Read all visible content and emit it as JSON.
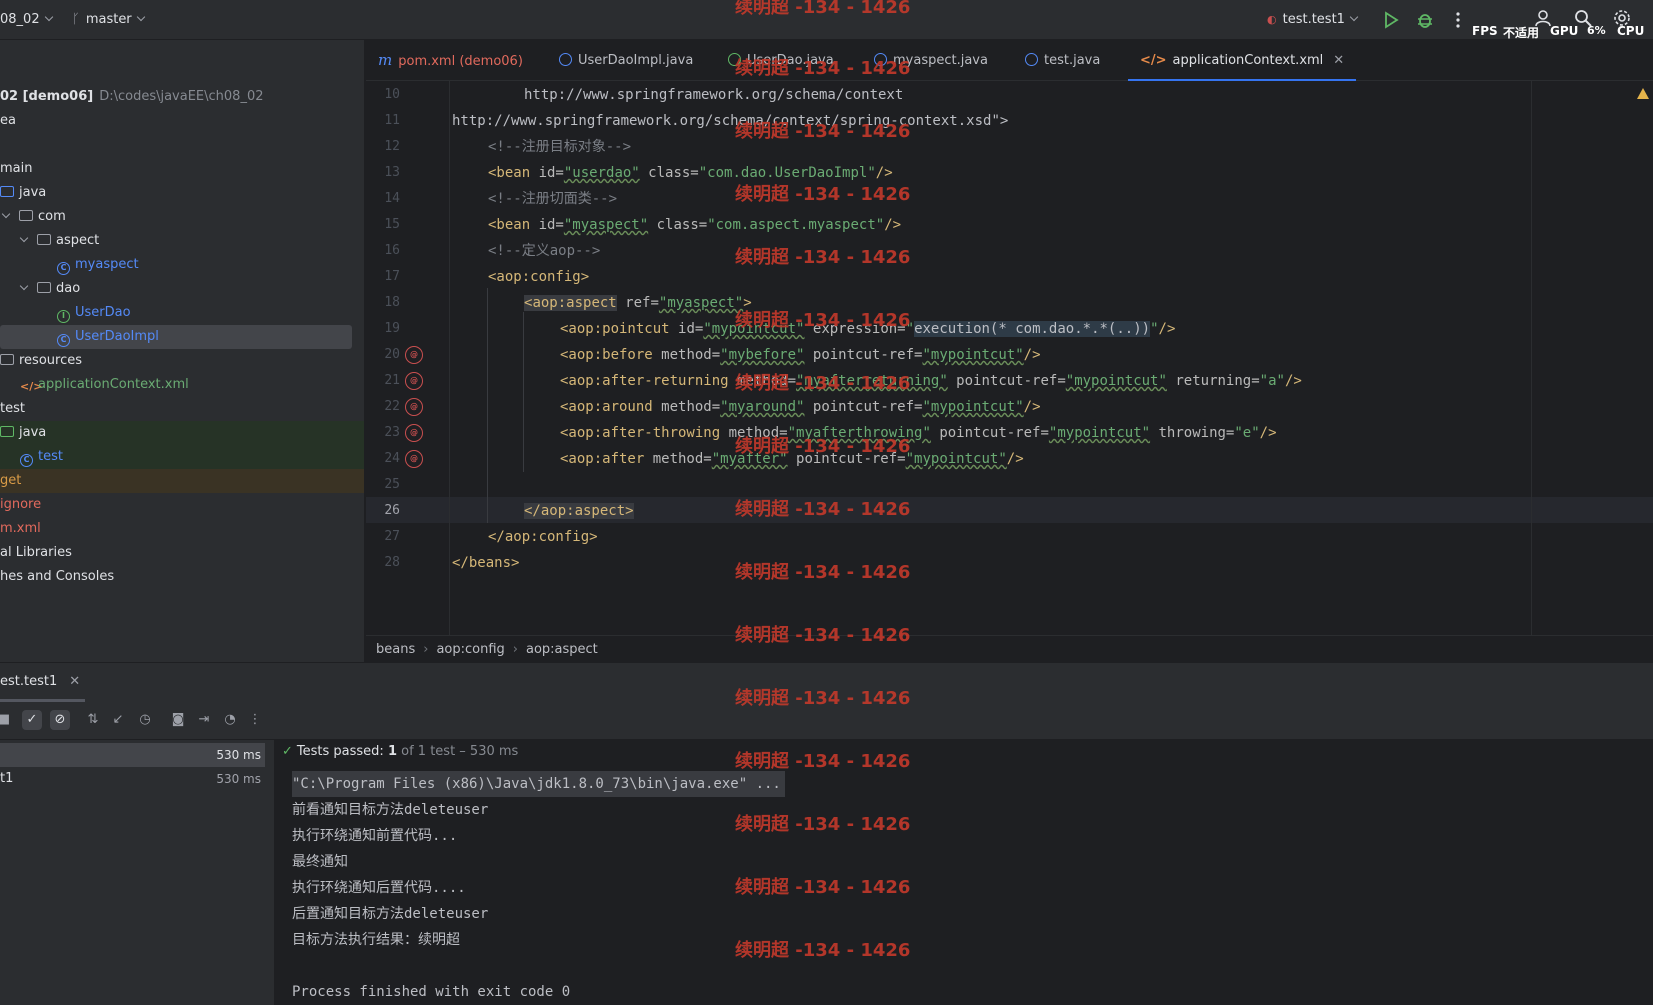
{
  "titlebar": {
    "project_name": "08_02",
    "branch": "master",
    "run_config": "test.test1",
    "perf_fps": "FPS",
    "perf_na": "不适用",
    "perf_gpu": "GPU",
    "perf_cpu_value": "6%",
    "perf_cpu": "CPU"
  },
  "project_tree": {
    "root": {
      "name": "02 [demo06]",
      "path": "D:\\codes\\javaEE\\ch08_02"
    },
    "items": [
      {
        "label": "ea"
      },
      {
        "label": "main"
      },
      {
        "label": "java"
      },
      {
        "label": "com"
      },
      {
        "label": "aspect"
      },
      {
        "label": "myaspect"
      },
      {
        "label": "dao"
      },
      {
        "label": "UserDao"
      },
      {
        "label": "UserDaoImpl"
      },
      {
        "label": "resources"
      },
      {
        "label": "applicationContext.xml"
      },
      {
        "label": "test"
      },
      {
        "label": "java"
      },
      {
        "label": "test"
      },
      {
        "label": "get"
      },
      {
        "label": "ignore"
      },
      {
        "label": "m.xml"
      },
      {
        "label": "al Libraries"
      },
      {
        "label": "hes and Consoles"
      }
    ]
  },
  "tabs": [
    {
      "label": "pom.xml (demo06)"
    },
    {
      "label": "UserDaoImpl.java"
    },
    {
      "label": "UserDao.java"
    },
    {
      "label": "myaspect.java"
    },
    {
      "label": "test.java"
    },
    {
      "label": "applicationContext.xml"
    }
  ],
  "editor": {
    "line_numbers": [
      "10",
      "11",
      "12",
      "13",
      "14",
      "15",
      "16",
      "17",
      "18",
      "19",
      "20",
      "21",
      "22",
      "23",
      "24",
      "25",
      "26",
      "27",
      "28"
    ],
    "l10": "http://www.springframework.org/schema/context",
    "l11": "http://www.springframework.org/schema/context/spring-context.xsd\">",
    "l12": "<!--注册目标对象-->",
    "l13": {
      "tag": "<bean ",
      "a1": "id=",
      "v1": "\"userdao\"",
      "a2": " class=",
      "v2": "\"com.dao.UserDaoImpl\"",
      "end": "/>"
    },
    "l14": "<!--注册切面类-->",
    "l15": {
      "tag": "<bean ",
      "a1": "id=",
      "v1": "\"myaspect\"",
      "a2": " class=",
      "v2": "\"com.aspect.myaspect\"",
      "end": "/>"
    },
    "l16": "<!--定义aop-->",
    "l17": "<aop:config>",
    "l18": {
      "lt": "<",
      "tag": "aop:aspect",
      "a1": " ref=",
      "v1": "\"myaspect\"",
      "end": ">"
    },
    "l19": {
      "tag": "<aop:pointcut ",
      "a1": "id=",
      "v1": "\"mypointcut\"",
      "a2": " expression=",
      "q1": "\"",
      "expr": "execution(* com.dao.*.*(..))",
      "q2": "\"",
      "end": "/>"
    },
    "l20": {
      "tag": "<aop:before ",
      "a1": "method=",
      "v1": "\"mybefore\"",
      "a2": " pointcut-ref=",
      "v2": "\"mypointcut\"",
      "end": "/>"
    },
    "l21": {
      "tag": "<aop:after-returning ",
      "a1": "method=",
      "v1": "\"myafterreturning\"",
      "a2": " pointcut-ref=",
      "v2": "\"mypointcut\"",
      "a3": " returning=",
      "v3": "\"a\"",
      "end": "/>"
    },
    "l22": {
      "tag": "<aop:around ",
      "a1": "method=",
      "v1": "\"myaround\"",
      "a2": " pointcut-ref=",
      "v2": "\"mypointcut\"",
      "end": "/>"
    },
    "l23": {
      "tag": "<aop:after-throwing ",
      "a1": "method=",
      "v1": "\"myafterthrowing\"",
      "a2": " pointcut-ref=",
      "v2": "\"mypointcut\"",
      "a3": " throwing=",
      "v3": "\"e\"",
      "end": "/>"
    },
    "l24": {
      "tag": "<aop:after ",
      "a1": "method=",
      "v1": "\"myafter\"",
      "a2": " pointcut-ref=",
      "v2": "\"mypointcut\"",
      "end": "/>"
    },
    "l26": {
      "open": "</",
      "tag": "aop:aspect",
      "end": ">"
    },
    "l27": "</aop:config>",
    "l28": "</beans>"
  },
  "breadcrumb": [
    "beans",
    "aop:config",
    "aop:aspect"
  ],
  "run": {
    "tab_label": "est.test1",
    "tree": [
      {
        "label": "",
        "duration": "530 ms"
      },
      {
        "label": "t1",
        "duration": "530 ms"
      }
    ],
    "status_prefix": "Tests passed: ",
    "status_count": "1",
    "status_suffix": " of 1 test – 530 ms",
    "console": [
      "\"C:\\Program Files (x86)\\Java\\jdk1.8.0_73\\bin\\java.exe\" ...",
      "前看通知目标方法deleteuser",
      "执行环绕通知前置代码...",
      "最终通知",
      "执行环绕通知后置代码....",
      "后置通知目标方法deleteuser",
      "目标方法执行结果：续明超",
      "",
      "Process finished with exit code 0"
    ]
  },
  "watermark": "续明超 -134 - 1426",
  "colors": {
    "accent": "#3574f0",
    "tag": "#d5b778",
    "string": "#6aab73",
    "comment": "#7a7e85",
    "watermark": "#c0392b"
  }
}
